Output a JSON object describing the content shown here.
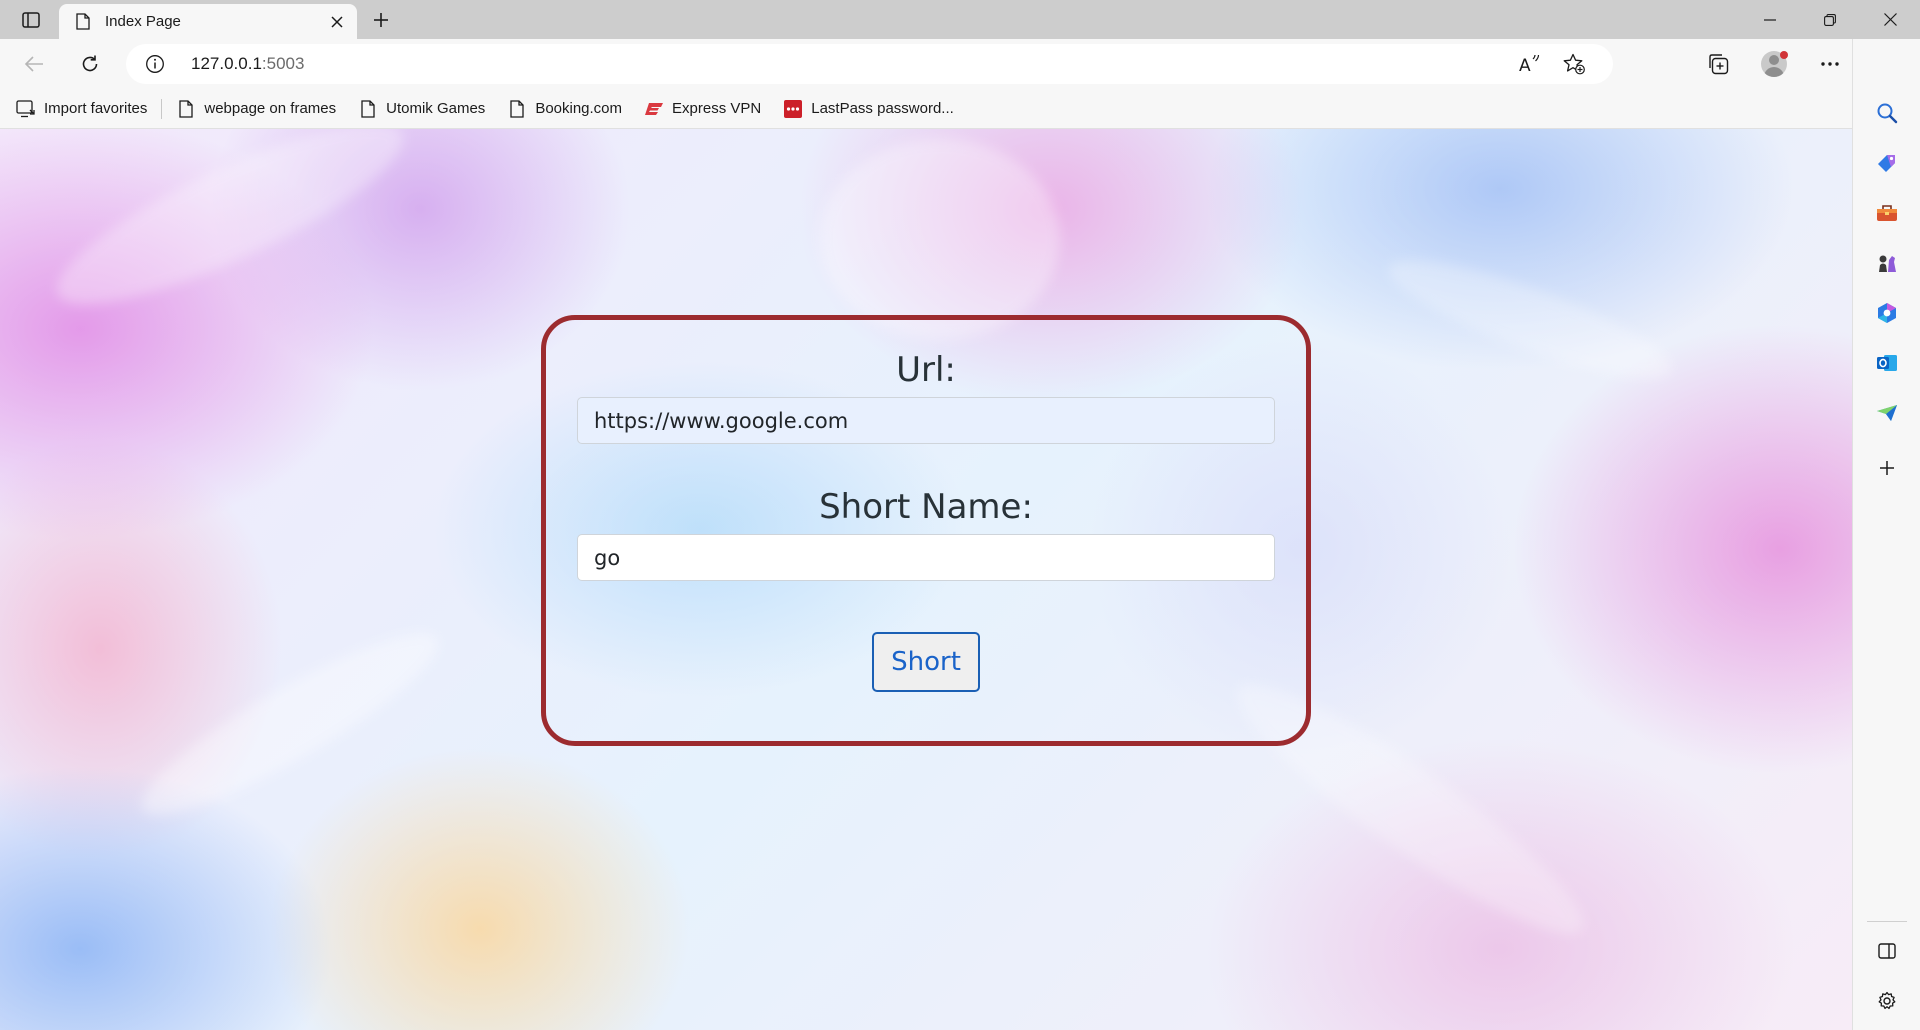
{
  "browser": {
    "tab": {
      "title": "Index Page"
    },
    "address_bar": {
      "host": "127.0.0.1",
      "port": ":5003"
    },
    "favorites": [
      {
        "label": "Import favorites",
        "icon": "import-favorites-icon"
      },
      {
        "label": "webpage on frames",
        "icon": "page-icon"
      },
      {
        "label": "Utomik Games",
        "icon": "page-icon"
      },
      {
        "label": "Booking.com",
        "icon": "page-icon"
      },
      {
        "label": "Express VPN",
        "icon": "expressvpn-icon"
      },
      {
        "label": "LastPass password...",
        "icon": "lastpass-icon"
      }
    ],
    "colors": {
      "bing": "#1a73e8",
      "profile_dot": "#d13438",
      "expressvpn": "#da3940",
      "lastpass": "#cc2029"
    }
  },
  "form": {
    "url_label": "Url:",
    "url_value": "https://www.google.com",
    "short_name_label": "Short Name:",
    "short_name_value": "go",
    "submit_label": "Short",
    "colors": {
      "card_border": "#9c2b2f",
      "button_text": "#1a63c9",
      "url_field_bg": "#e8f0fe"
    }
  }
}
